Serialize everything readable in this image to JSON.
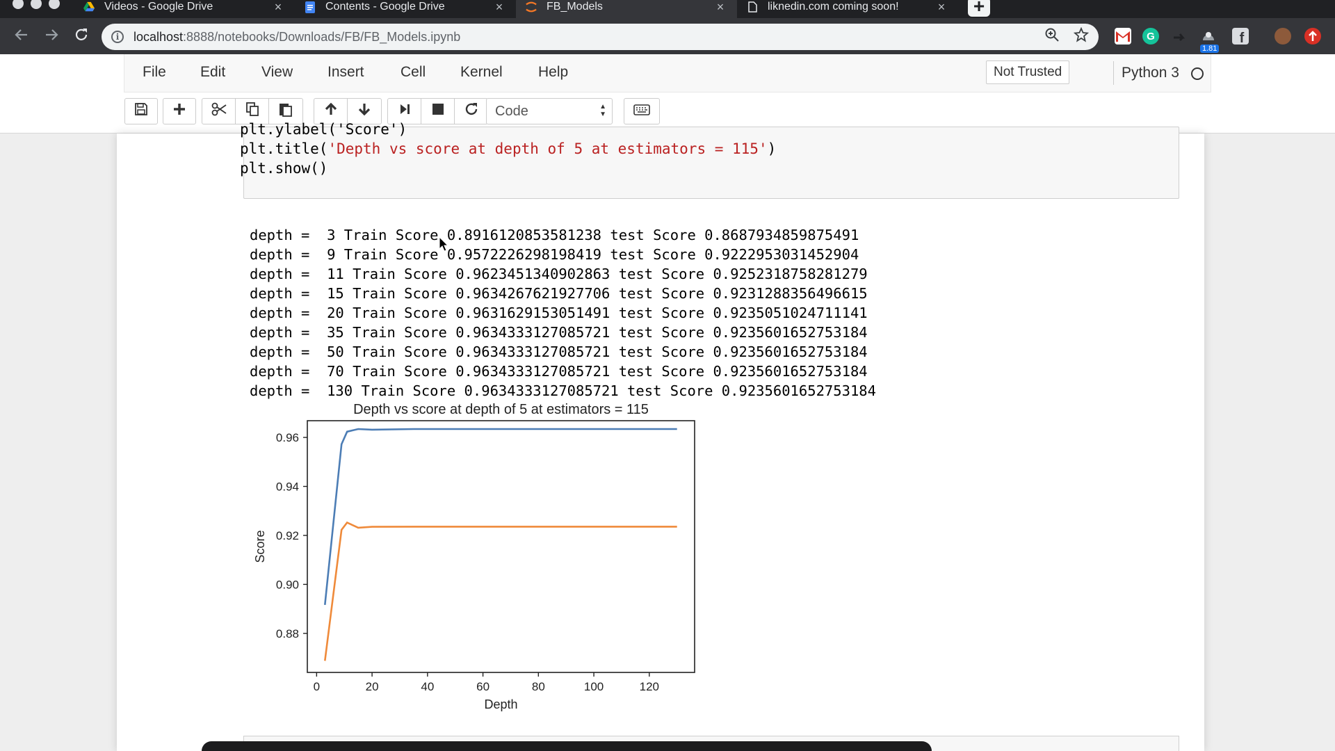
{
  "browser": {
    "tabs": [
      {
        "title": "Videos - Google Drive",
        "icon": "google-drive-icon",
        "active": false
      },
      {
        "title": "Contents - Google Drive",
        "icon": "google-docs-icon",
        "active": false
      },
      {
        "title": "FB_Models",
        "icon": "jupyter-icon",
        "active": true
      },
      {
        "title": "liknedin.com coming soon!",
        "icon": "page-icon",
        "active": false
      }
    ],
    "close_glyph": "×",
    "new_tab_glyph": "+",
    "url_host": "localhost",
    "url_path": ":8888/notebooks/Downloads/FB/FB_Models.ipynb",
    "extension_badge": "1.81"
  },
  "jupyter": {
    "menu": [
      "File",
      "Edit",
      "View",
      "Insert",
      "Cell",
      "Kernel",
      "Help"
    ],
    "trust_status": "Not Trusted",
    "kernel_name": "Python 3",
    "cell_type": "Code",
    "toolbar_icons": [
      "save-icon",
      "add-cell-icon",
      "cut-icon",
      "copy-icon",
      "paste-icon",
      "move-up-icon",
      "move-down-icon",
      "run-icon",
      "stop-icon",
      "restart-icon",
      "keyboard-icon"
    ]
  },
  "code": {
    "line_partial": "plt.ylabel('Score')",
    "title_prefix": "plt.title(",
    "title_string": "'Depth vs score at depth of 5 at estimators = 115'",
    "title_suffix": ")",
    "show": "plt.show()"
  },
  "output_lines": [
    "depth =  3 Train Score 0.8916120853581238 test Score 0.8687934859875491",
    "depth =  9 Train Score 0.9572226298198419 test Score 0.9222953031452904",
    "depth =  11 Train Score 0.9623451340902863 test Score 0.9252318758281279",
    "depth =  15 Train Score 0.9634267621927706 test Score 0.9231288356496615",
    "depth =  20 Train Score 0.9631629153051491 test Score 0.9235051024711141",
    "depth =  35 Train Score 0.9634333127085721 test Score 0.9235601652753184",
    "depth =  50 Train Score 0.9634333127085721 test Score 0.9235601652753184",
    "depth =  70 Train Score 0.9634333127085721 test Score 0.9235601652753184",
    "depth =  130 Train Score 0.9634333127085721 test Score 0.9235601652753184"
  ],
  "chart_data": {
    "type": "line",
    "title": "Depth vs score at depth of 5 at estimators = 115",
    "xlabel": "Depth",
    "ylabel": "Score",
    "x": [
      3,
      9,
      11,
      15,
      20,
      35,
      50,
      70,
      130
    ],
    "series": [
      {
        "values": [
          0.8916120853581238,
          0.9572226298198419,
          0.9623451340902863,
          0.9634267621927706,
          0.9631629153051491,
          0.9634333127085721,
          0.9634333127085721,
          0.9634333127085721,
          0.9634333127085721
        ],
        "color": "#4c7db5"
      },
      {
        "values": [
          0.8687934859875491,
          0.9222953031452904,
          0.9252318758281279,
          0.9231288356496615,
          0.9235051024711141,
          0.9235601652753184,
          0.9235601652753184,
          0.9235601652753184,
          0.9235601652753184
        ],
        "color": "#ef8a3a"
      }
    ],
    "xlim": [
      -3.35,
      136.35
    ],
    "ylim": [
      0.86406,
      0.96683
    ],
    "xticks": [
      0,
      20,
      40,
      60,
      80,
      100,
      120
    ],
    "yticks": [
      0.88,
      0.9,
      0.92,
      0.94,
      0.96
    ],
    "ytick_labels": [
      "0.88",
      "0.90",
      "0.92",
      "0.94",
      "0.96"
    ],
    "grid": false
  }
}
